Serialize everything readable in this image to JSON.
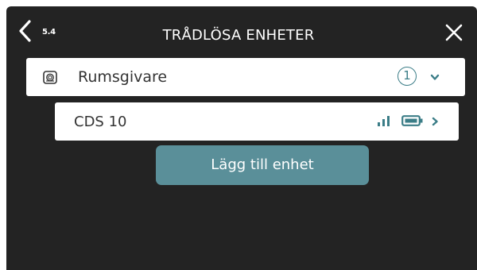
{
  "header": {
    "section_number": "5.4",
    "title": "TRÅDLÖSA ENHETER"
  },
  "devices": {
    "group": {
      "label": "Rumsgivare",
      "count": "1",
      "icon": "room-sensor-icon"
    },
    "unit": {
      "label": "CDS 10",
      "signal_icon": "signal-strength-icon",
      "battery_icon": "battery-icon"
    }
  },
  "actions": {
    "add_device_label": "Lägg till enhet"
  },
  "colors": {
    "background": "#232323",
    "accent": "#3b7d87",
    "button": "#5a8f99",
    "row": "#ffffff"
  }
}
